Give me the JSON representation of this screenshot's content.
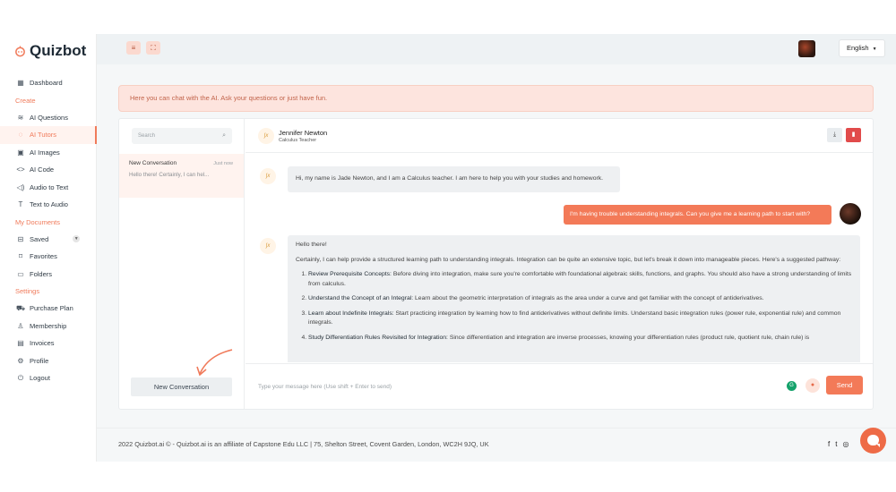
{
  "app": {
    "name": "Quizbot"
  },
  "sidebar": {
    "dashboard": "Dashboard",
    "sections": {
      "create": "Create",
      "documents": "My Documents",
      "settings": "Settings"
    },
    "create_items": [
      {
        "label": "AI Questions",
        "icon": "layers-icon"
      },
      {
        "label": "AI Tutors",
        "icon": "chat-bubble-icon"
      },
      {
        "label": "AI Images",
        "icon": "image-icon"
      },
      {
        "label": "AI Code",
        "icon": "code-icon"
      },
      {
        "label": "Audio to Text",
        "icon": "speaker-icon"
      },
      {
        "label": "Text to Audio",
        "icon": "text-icon"
      }
    ],
    "document_items": [
      {
        "label": "Saved",
        "icon": "inbox-icon"
      },
      {
        "label": "Favorites",
        "icon": "bookmark-icon"
      },
      {
        "label": "Folders",
        "icon": "folder-icon"
      }
    ],
    "settings_items": [
      {
        "label": "Purchase Plan",
        "icon": "cart-icon"
      },
      {
        "label": "Membership",
        "icon": "user-icon"
      },
      {
        "label": "Invoices",
        "icon": "invoice-icon"
      },
      {
        "label": "Profile",
        "icon": "gear-icon"
      },
      {
        "label": "Logout",
        "icon": "power-icon"
      }
    ]
  },
  "topbar": {
    "language": "English"
  },
  "banner": {
    "text": "Here you can chat with the AI. Ask your questions or just have fun."
  },
  "conversations": {
    "search_placeholder": "Search",
    "items": [
      {
        "title": "New Conversation",
        "time": "Just now",
        "preview": "Hello there! Certainly, I can hel..."
      }
    ],
    "new_button": "New Conversation"
  },
  "chat": {
    "tutor_name": "Jennifer Newton",
    "tutor_role": "Calculus Teacher",
    "avatar_symbol": "∫x",
    "messages": {
      "greeting": "Hi, my name is Jade Newton, and I am a Calculus teacher. I am here to help you with your studies and homework.",
      "user": "I'm having trouble understanding integrals. Can you give me a learning path to start with?",
      "reply_hello": "Hello there!",
      "reply_intro": "Certainly, I can help provide a structured learning path to understanding integrals. Integration can be quite an extensive topic, but let's break it down into manageable pieces. Here's a suggested pathway:",
      "steps": [
        {
          "title": "Review Prerequisite Concepts:",
          "text": "Before diving into integration, make sure you're comfortable with foundational algebraic skills, functions, and graphs. You should also have a strong understanding of limits from calculus."
        },
        {
          "title": "Understand the Concept of an Integral:",
          "text": "Learn about the geometric interpretation of integrals as the area under a curve and get familiar with the concept of antiderivatives."
        },
        {
          "title": "Learn about Indefinite Integrals:",
          "text": "Start practicing integration by learning how to find antiderivatives without definite limits. Understand basic integration rules (power rule, exponential rule) and common integrals."
        },
        {
          "title": "Study Differentiation Rules Revisited for Integration:",
          "text": "Since differentiation and integration are inverse processes, knowing your differentiation rules (product rule, quotient rule, chain rule) is"
        }
      ]
    },
    "composer_placeholder": "Type your message here (Use shift + Enter to send)",
    "send_label": "Send"
  },
  "footer": {
    "copyright": "2022 Quizbot.ai © - Quizbot.ai is an affiliate of Capstone Edu LLC | 75, Shelton Street, Covent Garden, London, WC2H 9JQ, UK"
  },
  "colors": {
    "accent": "#f37a58",
    "accent_light": "#fde4de"
  }
}
